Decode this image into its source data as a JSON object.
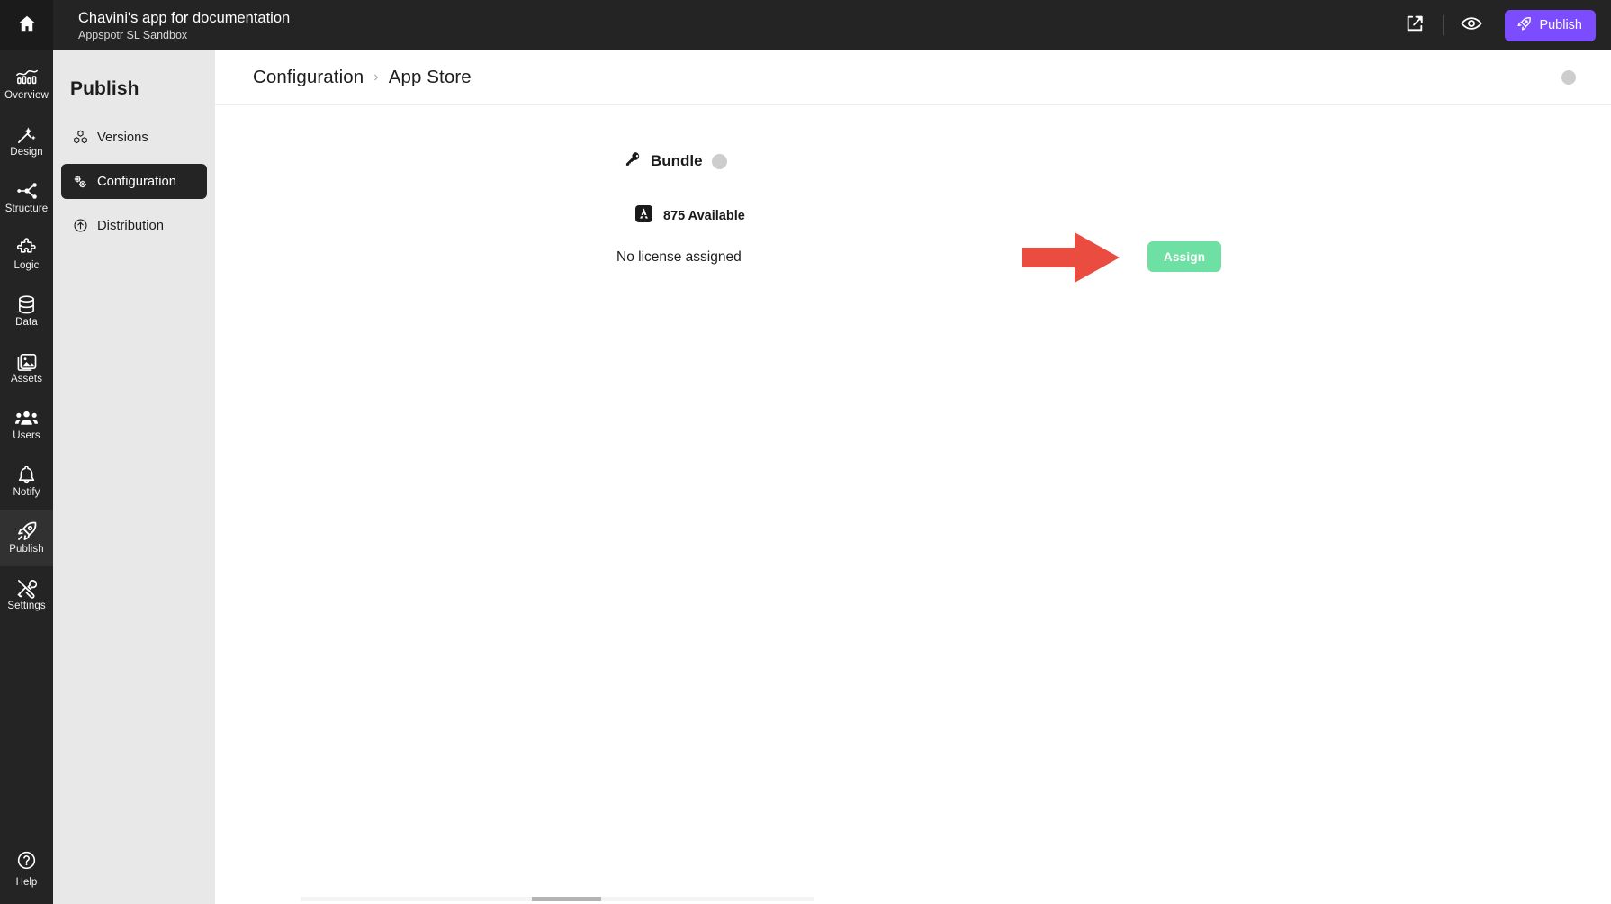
{
  "header": {
    "title": "Chavini's app for documentation",
    "subtitle": "Appspotr SL Sandbox",
    "publish_label": "Publish",
    "share_icon": "share-icon",
    "preview_icon": "eye-icon",
    "rocket_icon": "rocket-icon",
    "accent_color": "#7c4dff",
    "bar_color": "#242424"
  },
  "rail": {
    "home_icon": "home-icon",
    "items": [
      {
        "label": "Overview",
        "icon": "chart-icon",
        "active": false
      },
      {
        "label": "Design",
        "icon": "magic-wand-icon",
        "active": false
      },
      {
        "label": "Structure",
        "icon": "structure-icon",
        "active": false
      },
      {
        "label": "Logic",
        "icon": "puzzle-icon",
        "active": false
      },
      {
        "label": "Data",
        "icon": "database-icon",
        "active": false
      },
      {
        "label": "Assets",
        "icon": "image-icon",
        "active": false
      },
      {
        "label": "Users",
        "icon": "users-icon",
        "active": false
      },
      {
        "label": "Notify",
        "icon": "bell-icon",
        "active": false
      },
      {
        "label": "Publish",
        "icon": "rocket-icon",
        "active": true
      },
      {
        "label": "Settings",
        "icon": "tools-icon",
        "active": false
      }
    ],
    "help": {
      "label": "Help",
      "icon": "question-circle-icon"
    }
  },
  "panel": {
    "title": "Publish",
    "items": [
      {
        "label": "Versions",
        "icon": "boxes-icon",
        "active": false
      },
      {
        "label": "Configuration",
        "icon": "gears-icon",
        "active": true
      },
      {
        "label": "Distribution",
        "icon": "arrow-up-circle-icon",
        "active": false
      }
    ]
  },
  "breadcrumb": {
    "parent": "Configuration",
    "separator": "›",
    "current": "App Store",
    "status_dot_color": "#cdcdcd"
  },
  "content": {
    "bundle_label": "Bundle",
    "bundle_icon": "key-icon",
    "bundle_status_color": "#cdcdcd",
    "store_icon": "app-store-icon",
    "store_count": "875 Available",
    "license_text": "No license assigned",
    "assign_label": "Assign",
    "assign_color": "#6fe0a3",
    "arrow_color": "#ea4c40"
  }
}
